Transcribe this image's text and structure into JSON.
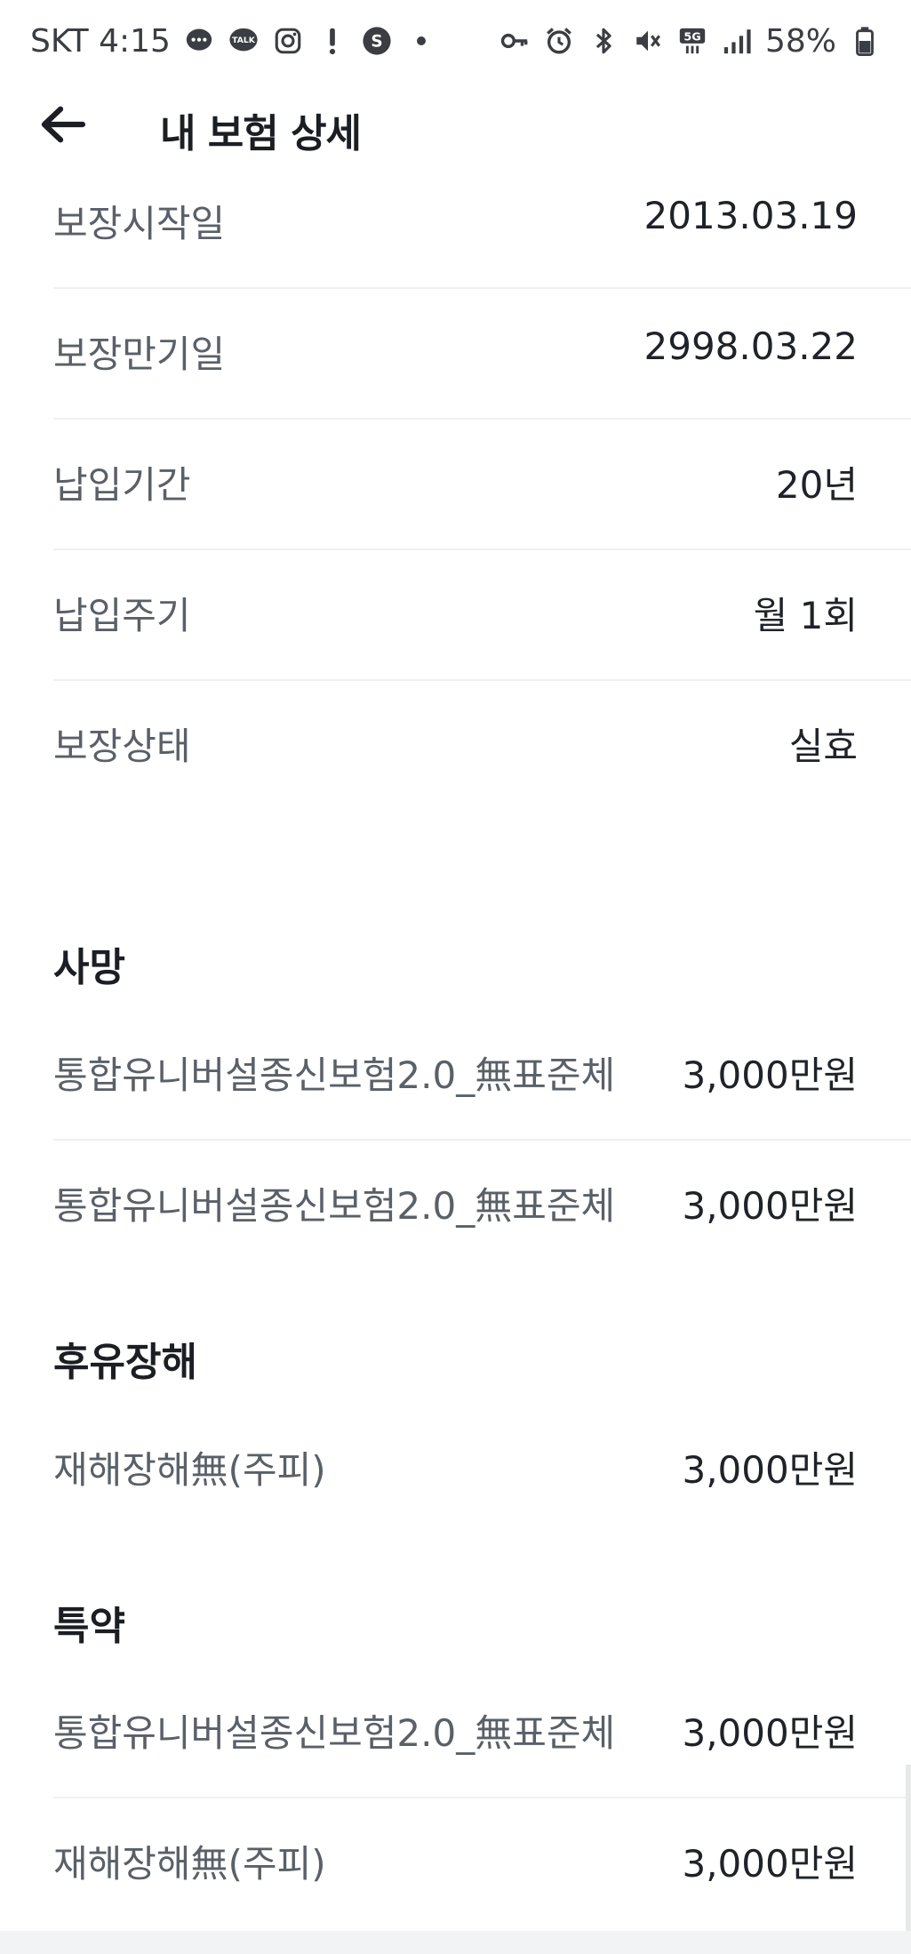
{
  "status_bar": {
    "carrier_time": "SKT 4:15",
    "left_icons": [
      "chat-bubble-icon",
      "kakaotalk-icon",
      "instagram-icon",
      "exclamation-icon",
      "s-circle-icon",
      "dot-icon"
    ],
    "talk_label": "TALK",
    "right_icons": [
      "key-icon",
      "alarm-icon",
      "bluetooth-icon",
      "mute-icon",
      "5g-icon",
      "signal-icon",
      "battery-icon"
    ],
    "network_label": "5G",
    "battery": "58%"
  },
  "header": {
    "title": "내 보험 상세"
  },
  "info_rows": [
    {
      "label": "보장시작일",
      "value": "2013.03.19"
    },
    {
      "label": "보장만기일",
      "value": "2998.03.22"
    },
    {
      "label": "납입기간",
      "value": "20년"
    },
    {
      "label": "납입주기",
      "value": "월 1회"
    },
    {
      "label": "보장상태",
      "value": "실효"
    }
  ],
  "sections": [
    {
      "title": "사망",
      "items": [
        {
          "label": "통합유니버설종신보험2.0_無표준체",
          "value": "3,000만원"
        },
        {
          "label": "통합유니버설종신보험2.0_無표준체",
          "value": "3,000만원"
        }
      ]
    },
    {
      "title": "후유장해",
      "items": [
        {
          "label": "재해장해無(주피)",
          "value": "3,000만원"
        }
      ]
    },
    {
      "title": "특약",
      "items": [
        {
          "label": "통합유니버설종신보험2.0_無표준체",
          "value": "3,000만원"
        },
        {
          "label": "재해장해無(주피)",
          "value": "3,000만원"
        }
      ]
    }
  ]
}
